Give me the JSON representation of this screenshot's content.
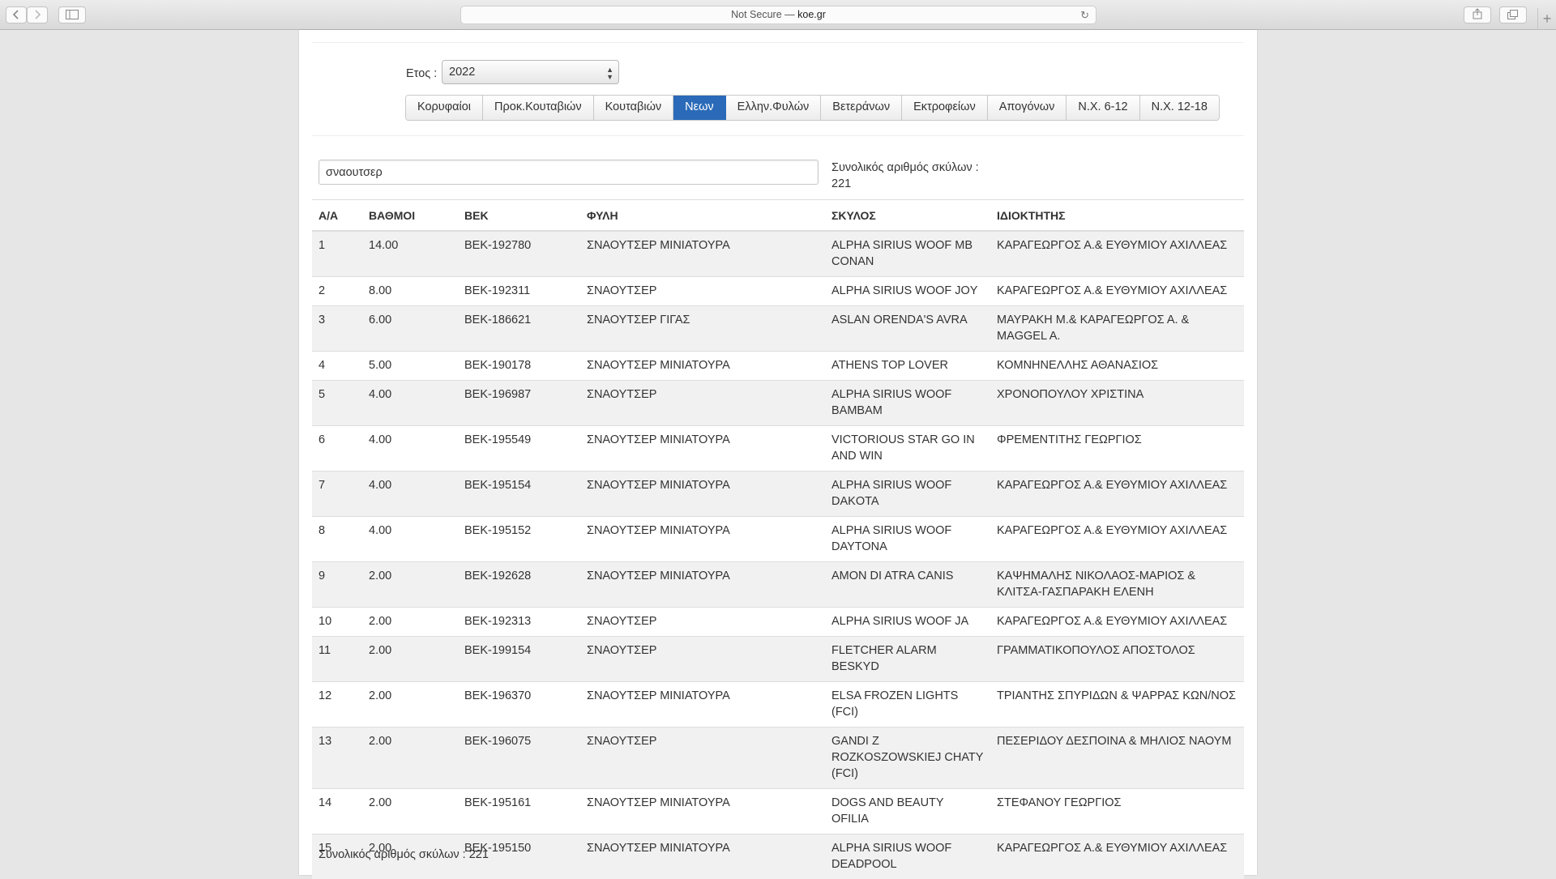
{
  "browser": {
    "security": "Not Secure —",
    "domain": "koe.gr",
    "back_icon": "chevron-left-icon",
    "forward_icon": "chevron-right-icon",
    "sidebar_icon": "sidebar-icon",
    "share_icon": "share-icon",
    "tabs_icon": "tabs-overview-icon",
    "reload_icon": "reload-icon",
    "new_tab_icon": "plus-icon"
  },
  "filter": {
    "year_label": "Ετος :",
    "year_value": "2022"
  },
  "tabs": [
    {
      "label": "Κορυφαίοι",
      "active": false
    },
    {
      "label": "Προκ.Κουταβιών",
      "active": false
    },
    {
      "label": "Κουταβιών",
      "active": false
    },
    {
      "label": "Νεων",
      "active": true
    },
    {
      "label": "Ελλην.Φυλών",
      "active": false
    },
    {
      "label": "Βετεράνων",
      "active": false
    },
    {
      "label": "Εκτροφείων",
      "active": false
    },
    {
      "label": "Απογόνων",
      "active": false
    },
    {
      "label": "Ν.Χ. 6-12",
      "active": false
    },
    {
      "label": "Ν.Χ. 12-18",
      "active": false
    }
  ],
  "search": {
    "value": "σναουτσερ"
  },
  "total_top": "Συνολικός αριθμός σκύλων : 221",
  "total_bottom": "Συνολικός αριθμός σκύλων : 221",
  "table": {
    "headers": [
      "Α/Α",
      "ΒΑΘΜΟΙ",
      "ΒΕΚ",
      "ΦΥΛΗ",
      "ΣΚΥΛΟΣ",
      "ΙΔΙΟΚΤΗΤΗΣ"
    ],
    "rows": [
      [
        "1",
        "14.00",
        "ΒΕΚ-192780",
        "ΣΝΑΟΥΤΣΕΡ ΜΙΝΙΑΤΟΥΡΑ",
        "ALPHA SIRIUS WOOF MB CONAN",
        "ΚΑΡΑΓΕΩΡΓΟΣ Α.& ΕΥΘΥΜΙΟΥ ΑΧΙΛΛΕΑΣ"
      ],
      [
        "2",
        "8.00",
        "ΒΕΚ-192311",
        "ΣΝΑΟΥΤΣΕΡ",
        "ALPHA SIRIUS WOOF JOY",
        "ΚΑΡΑΓΕΩΡΓΟΣ Α.& ΕΥΘΥΜΙΟΥ ΑΧΙΛΛΕΑΣ"
      ],
      [
        "3",
        "6.00",
        "ΒΕΚ-186621",
        "ΣΝΑΟΥΤΣΕΡ ΓΙΓΑΣ",
        "ASLAN ORENDA'S AVRA",
        "ΜΑΥΡΑΚΗ Μ.& ΚΑΡΑΓΕΩΡΓΟΣ Α. & MAGGEL A."
      ],
      [
        "4",
        "5.00",
        "ΒΕΚ-190178",
        "ΣΝΑΟΥΤΣΕΡ ΜΙΝΙΑΤΟΥΡΑ",
        "ATHENS TOP LOVER",
        "ΚΟΜΝΗΝΕΛΛΗΣ ΑΘΑΝΑΣΙΟΣ"
      ],
      [
        "5",
        "4.00",
        "ΒΕΚ-196987",
        "ΣΝΑΟΥΤΣΕΡ",
        "ALPHA SIRIUS WOOF BAMBAM",
        "ΧΡΟΝΟΠΟΥΛΟΥ ΧΡΙΣΤΙΝΑ"
      ],
      [
        "6",
        "4.00",
        "ΒΕΚ-195549",
        "ΣΝΑΟΥΤΣΕΡ ΜΙΝΙΑΤΟΥΡΑ",
        "VICTORIOUS STAR GO IN AND WIN",
        "ΦΡΕΜΕΝΤΙΤΗΣ ΓΕΩΡΓΙΟΣ"
      ],
      [
        "7",
        "4.00",
        "ΒΕΚ-195154",
        "ΣΝΑΟΥΤΣΕΡ ΜΙΝΙΑΤΟΥΡΑ",
        "ALPHA SIRIUS WOOF DAKOTA",
        "ΚΑΡΑΓΕΩΡΓΟΣ Α.& ΕΥΘΥΜΙΟΥ ΑΧΙΛΛΕΑΣ"
      ],
      [
        "8",
        "4.00",
        "ΒΕΚ-195152",
        "ΣΝΑΟΥΤΣΕΡ ΜΙΝΙΑΤΟΥΡΑ",
        "ALPHA SIRIUS WOOF DAYTONA",
        "ΚΑΡΑΓΕΩΡΓΟΣ Α.& ΕΥΘΥΜΙΟΥ ΑΧΙΛΛΕΑΣ"
      ],
      [
        "9",
        "2.00",
        "ΒΕΚ-192628",
        "ΣΝΑΟΥΤΣΕΡ ΜΙΝΙΑΤΟΥΡΑ",
        "AMON DI ATRA CANIS",
        "ΚΑΨΗΜΑΛΗΣ ΝΙΚΟΛΑΟΣ-ΜΑΡΙΟΣ & ΚΛΙΤΣΑ-ΓΑΣΠΑΡΑΚΗ ΕΛΕΝΗ"
      ],
      [
        "10",
        "2.00",
        "ΒΕΚ-192313",
        "ΣΝΑΟΥΤΣΕΡ",
        "ALPHA SIRIUS WOOF JA",
        "ΚΑΡΑΓΕΩΡΓΟΣ Α.& ΕΥΘΥΜΙΟΥ ΑΧΙΛΛΕΑΣ"
      ],
      [
        "11",
        "2.00",
        "ΒΕΚ-199154",
        "ΣΝΑΟΥΤΣΕΡ",
        "FLETCHER ALARM BESKYD",
        "ΓΡΑΜΜΑΤΙΚΟΠΟΥΛΟΣ ΑΠΟΣΤΟΛΟΣ"
      ],
      [
        "12",
        "2.00",
        "ΒΕΚ-196370",
        "ΣΝΑΟΥΤΣΕΡ ΜΙΝΙΑΤΟΥΡΑ",
        "ELSA FROZEN LIGHTS (FCI)",
        "ΤΡΙΑΝΤΗΣ ΣΠΥΡΙΔΩΝ & ΨΑΡΡΑΣ ΚΩΝ/ΝΟΣ"
      ],
      [
        "13",
        "2.00",
        "ΒΕΚ-196075",
        "ΣΝΑΟΥΤΣΕΡ",
        "GANDI Z ROZKOSZOWSKIEJ CHATY (FCI)",
        "ΠΕΣΕΡΙΔΟΥ ΔΕΣΠΟΙΝΑ & ΜΗΛΙΟΣ ΝΑΟΥΜ"
      ],
      [
        "14",
        "2.00",
        "ΒΕΚ-195161",
        "ΣΝΑΟΥΤΣΕΡ ΜΙΝΙΑΤΟΥΡΑ",
        "DOGS AND BEAUTY OFILIA",
        "ΣΤΕΦΑΝΟΥ ΓΕΩΡΓΙΟΣ"
      ],
      [
        "15",
        "2.00",
        "ΒΕΚ-195150",
        "ΣΝΑΟΥΤΣΕΡ ΜΙΝΙΑΤΟΥΡΑ",
        "ALPHA SIRIUS WOOF DEADPOOL",
        "ΚΑΡΑΓΕΩΡΓΟΣ Α.& ΕΥΘΥΜΙΟΥ ΑΧΙΛΛΕΑΣ"
      ]
    ]
  }
}
